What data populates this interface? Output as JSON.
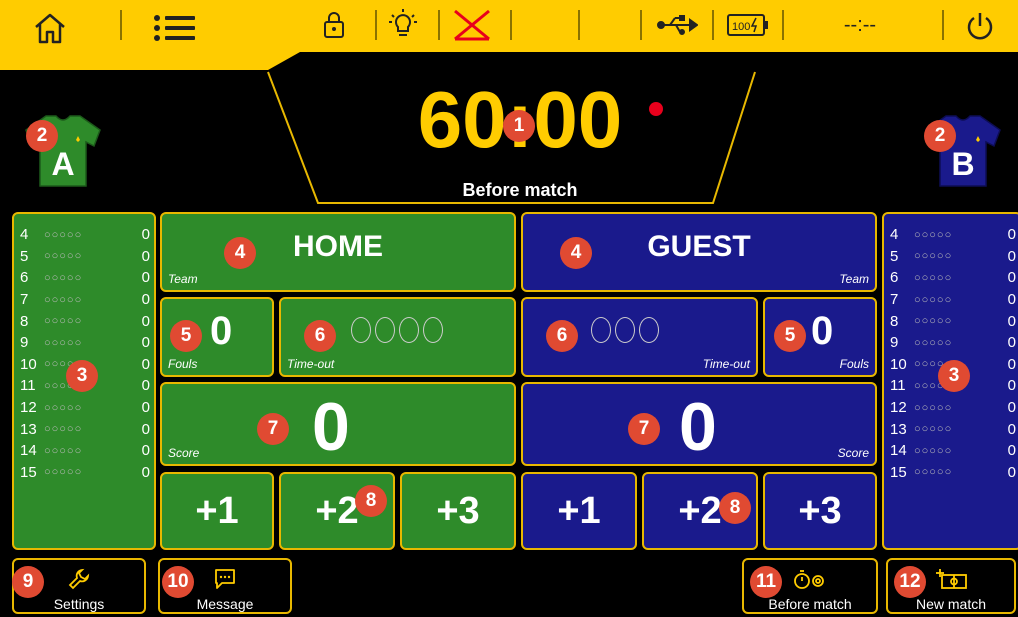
{
  "topbar": {
    "clock_display": "--:--"
  },
  "match": {
    "clock": "60:00",
    "phase": "Before match"
  },
  "home": {
    "letter": "A",
    "team_name": "HOME",
    "team_label": "Team",
    "fouls": "0",
    "fouls_label": "Fouls",
    "timeout_label": "Time-out",
    "score": "0",
    "score_label": "Score",
    "color": "#2e8b2a",
    "players": [
      {
        "num": "4",
        "pts": "0"
      },
      {
        "num": "5",
        "pts": "0"
      },
      {
        "num": "6",
        "pts": "0"
      },
      {
        "num": "7",
        "pts": "0"
      },
      {
        "num": "8",
        "pts": "0"
      },
      {
        "num": "9",
        "pts": "0"
      },
      {
        "num": "10",
        "pts": "0"
      },
      {
        "num": "11",
        "pts": "0"
      },
      {
        "num": "12",
        "pts": "0"
      },
      {
        "num": "13",
        "pts": "0"
      },
      {
        "num": "14",
        "pts": "0"
      },
      {
        "num": "15",
        "pts": "0"
      }
    ]
  },
  "guest": {
    "letter": "B",
    "team_name": "GUEST",
    "team_label": "Team",
    "fouls": "0",
    "fouls_label": "Fouls",
    "timeout_label": "Time-out",
    "score": "0",
    "score_label": "Score",
    "color": "#1a1a8c",
    "players": [
      {
        "num": "4",
        "pts": "0"
      },
      {
        "num": "5",
        "pts": "0"
      },
      {
        "num": "6",
        "pts": "0"
      },
      {
        "num": "7",
        "pts": "0"
      },
      {
        "num": "8",
        "pts": "0"
      },
      {
        "num": "9",
        "pts": "0"
      },
      {
        "num": "10",
        "pts": "0"
      },
      {
        "num": "11",
        "pts": "0"
      },
      {
        "num": "12",
        "pts": "0"
      },
      {
        "num": "13",
        "pts": "0"
      },
      {
        "num": "14",
        "pts": "0"
      },
      {
        "num": "15",
        "pts": "0"
      }
    ]
  },
  "score_buttons": [
    "+1",
    "+2",
    "+3"
  ],
  "bottom": {
    "settings": "Settings",
    "message": "Message",
    "before_match": "Before match",
    "new_match": "New match"
  },
  "callouts": [
    "1",
    "2",
    "3",
    "4",
    "5",
    "6",
    "7",
    "8",
    "9",
    "10",
    "11",
    "12"
  ],
  "colors": {
    "accent": "#ffcc00",
    "border": "#e8b800",
    "callout": "#e04a32"
  }
}
